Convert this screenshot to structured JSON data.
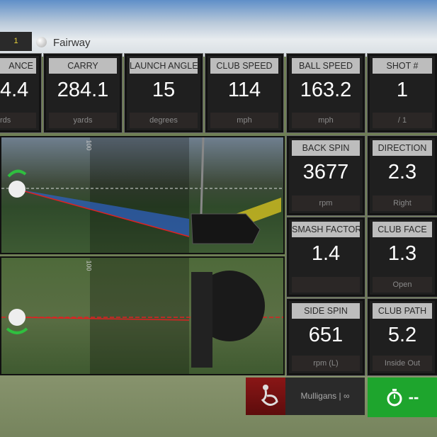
{
  "header": {
    "hole": "1",
    "lie": "Fairway"
  },
  "top_tiles": [
    {
      "label": "DISTANCE",
      "label_visible": "ANCE",
      "value": "4.4",
      "unit": "rds"
    },
    {
      "label": "CARRY",
      "value": "284.1",
      "unit": "yards"
    },
    {
      "label": "LAUNCH ANGLE",
      "value": "15",
      "unit": "degrees"
    },
    {
      "label": "CLUB SPEED",
      "value": "114",
      "unit": "mph"
    },
    {
      "label": "BALL SPEED",
      "value": "163.2",
      "unit": "mph"
    },
    {
      "label": "SHOT #",
      "value": "1",
      "unit": "/ 1"
    }
  ],
  "side_tiles": [
    {
      "label": "BACK SPIN",
      "value": "3677",
      "unit": "rpm"
    },
    {
      "label": "DIRECTION",
      "value": "2.3",
      "unit": "Right"
    },
    {
      "label": "SMASH FACTOR",
      "value": "1.4",
      "unit": ""
    },
    {
      "label": "CLUB FACE",
      "value": "1.3",
      "unit": "Open"
    },
    {
      "label": "SIDE SPIN",
      "value": "651",
      "unit": "rpm (L)"
    },
    {
      "label": "CLUB PATH",
      "value": "5.2",
      "unit": "Inside Out"
    }
  ],
  "views": {
    "side_marker": "100",
    "top_marker": "100"
  },
  "footer": {
    "mulligans": "Mulligans | ∞",
    "timer": "--"
  },
  "colors": {
    "timer_green": "#1ea52d",
    "mulligan_red": "#8a1616",
    "tile_label": "#bdbdbd"
  }
}
